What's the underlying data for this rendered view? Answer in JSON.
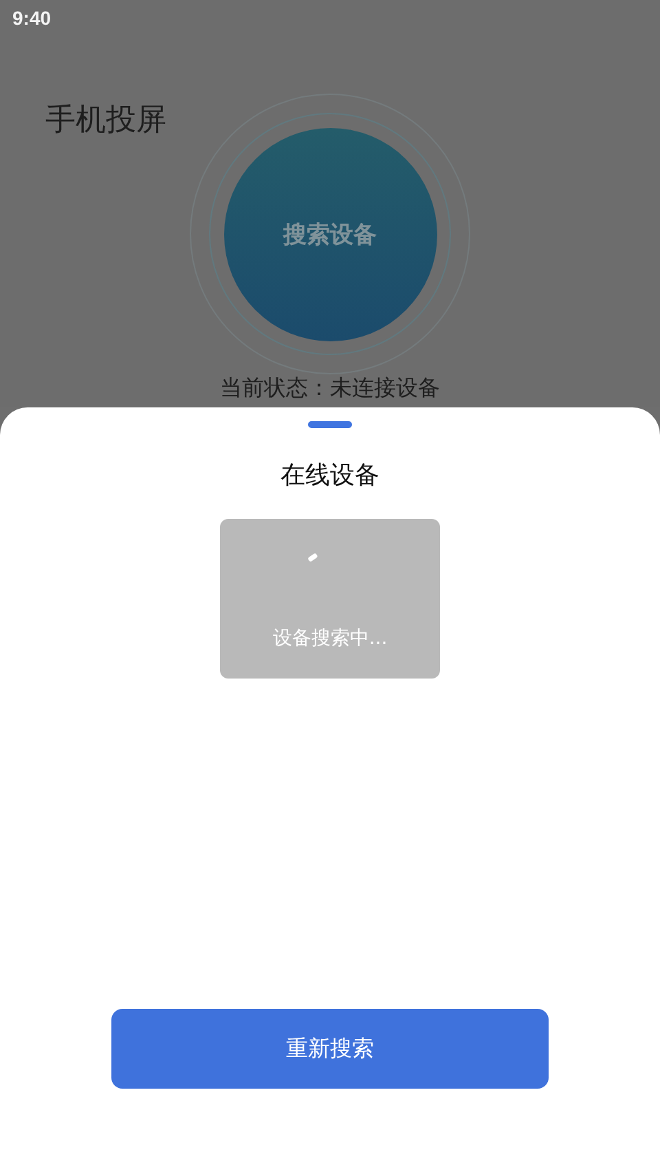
{
  "status_bar": {
    "time": "9:40"
  },
  "page": {
    "title": "手机投屏",
    "search_button": "搜索设备",
    "status_text": "当前状态：未连接设备"
  },
  "sheet": {
    "title": "在线设备",
    "loading": {
      "text": "设备搜索中..."
    },
    "button": "重新搜索"
  }
}
